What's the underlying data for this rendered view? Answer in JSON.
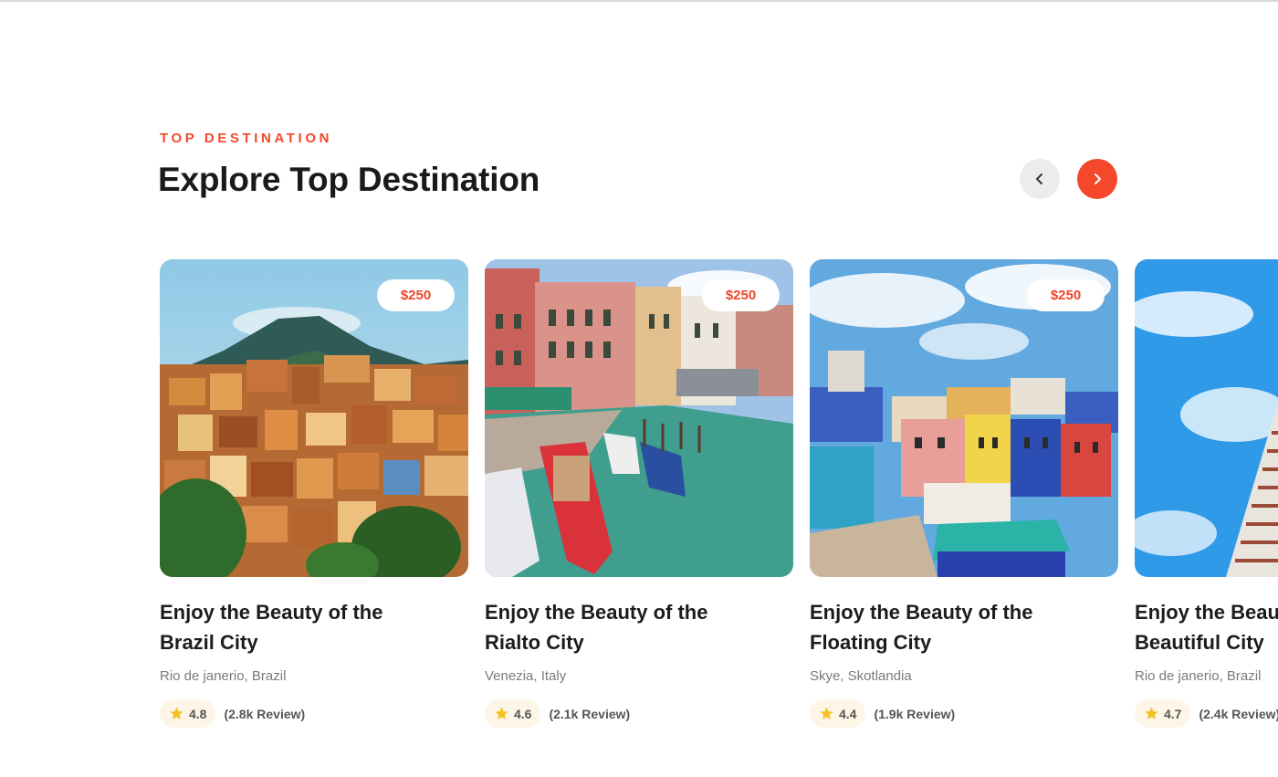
{
  "section": {
    "eyebrow": "TOP DESTINATION",
    "headline": "Explore Top Destination"
  },
  "nav": {
    "prev_icon": "chevron-left-icon",
    "next_icon": "chevron-right-icon"
  },
  "colors": {
    "accent": "#f5482b",
    "star": "#f5c021",
    "rating_bg": "#fdf6e6"
  },
  "cards": [
    {
      "price": "$250",
      "title": "Enjoy the Beauty of the Brazil City",
      "location": "Rio de janerio, Brazil",
      "rating": "4.8",
      "reviews": "(2.8k Review)"
    },
    {
      "price": "$250",
      "title": "Enjoy the Beauty of the Rialto City",
      "location": "Venezia, Italy",
      "rating": "4.6",
      "reviews": "(2.1k Review)"
    },
    {
      "price": "$250",
      "title": "Enjoy the Beauty of the Floating City",
      "location": "Skye, Skotlandia",
      "rating": "4.4",
      "reviews": "(1.9k Review)"
    },
    {
      "price": "",
      "title": "Enjoy the Beauty of the Beautiful City",
      "location": "Rio de janerio, Brazil",
      "rating": "4.7",
      "reviews": "(2.4k Review)"
    }
  ]
}
